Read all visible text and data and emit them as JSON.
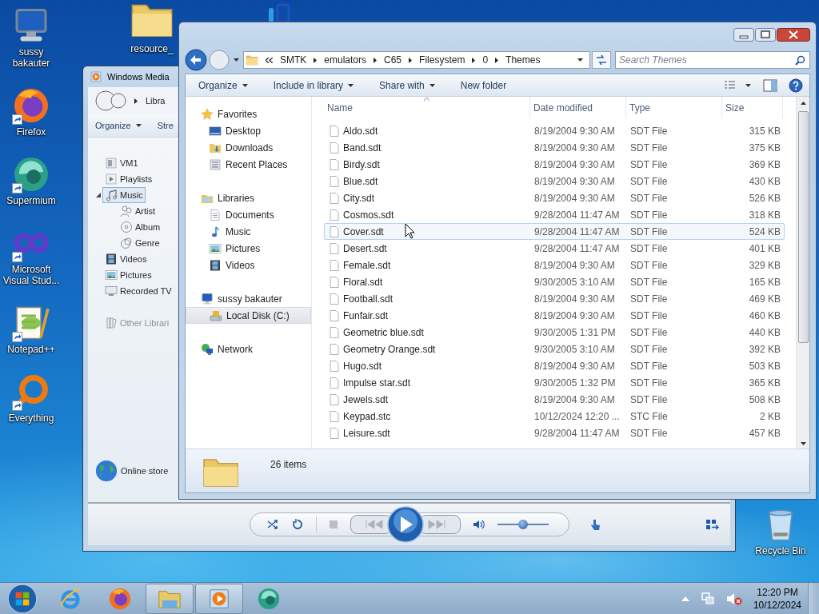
{
  "desktop_icons": [
    {
      "label": "sussy bakauter",
      "kind": "computer",
      "shortcut": false
    },
    {
      "label": "Firefox",
      "kind": "firefox",
      "shortcut": true
    },
    {
      "label": "Supermium",
      "kind": "supermium",
      "shortcut": true
    },
    {
      "label": "Microsoft Visual Stud...",
      "kind": "vs",
      "shortcut": true
    },
    {
      "label": "Notepad++",
      "kind": "notepad",
      "shortcut": true
    },
    {
      "label": "Everything",
      "kind": "everything",
      "shortcut": true
    }
  ],
  "desktop_folder": {
    "label": "resource_"
  },
  "recycle_bin": {
    "label": "Recycle Bin"
  },
  "media_player": {
    "title": "Windows Media",
    "breadcrumb": "Libra",
    "toolbar": [
      {
        "label": "Organize",
        "dropdown": true
      },
      {
        "label": "Stre",
        "dropdown": false
      }
    ],
    "tree": [
      {
        "label": "VM1",
        "kind": "device",
        "selected": false
      },
      {
        "label": "Playlists",
        "kind": "playlist",
        "selected": false
      },
      {
        "label": "Music",
        "kind": "music",
        "selected": true,
        "expanded": true,
        "children": [
          {
            "label": "Artist",
            "kind": "artist",
            "selected": false
          },
          {
            "label": "Album",
            "kind": "album",
            "selected": false
          },
          {
            "label": "Genre",
            "kind": "genre",
            "selected": false
          }
        ]
      },
      {
        "label": "Videos",
        "kind": "video",
        "selected": false
      },
      {
        "label": "Pictures",
        "kind": "picture",
        "selected": false
      },
      {
        "label": "Recorded TV",
        "kind": "tv",
        "selected": false
      }
    ],
    "other_libraries": "Other Librari",
    "online_store": "Online store",
    "volume": {
      "level": 0.5
    }
  },
  "explorer": {
    "address": [
      "SMTK",
      "emulators",
      "C65",
      "Filesystem",
      "0",
      "Themes"
    ],
    "search": {
      "placeholder": "Search Themes"
    },
    "toolbar": [
      {
        "label": "Organize",
        "dropdown": true
      },
      {
        "label": "Include in library",
        "dropdown": true
      },
      {
        "label": "Share with",
        "dropdown": true
      },
      {
        "label": "New folder",
        "dropdown": false
      }
    ],
    "navigation": [
      {
        "label": "Favorites",
        "kind": "star",
        "selected": false,
        "children": [
          {
            "label": "Desktop",
            "kind": "desktop",
            "selected": false
          },
          {
            "label": "Downloads",
            "kind": "downloads",
            "selected": false
          },
          {
            "label": "Recent Places",
            "kind": "recent",
            "selected": false
          }
        ]
      },
      {
        "label": "Libraries",
        "kind": "library",
        "selected": false,
        "children": [
          {
            "label": "Documents",
            "kind": "document",
            "selected": false
          },
          {
            "label": "Music",
            "kind": "note",
            "selected": false
          },
          {
            "label": "Pictures",
            "kind": "picture",
            "selected": false
          },
          {
            "label": "Videos",
            "kind": "video",
            "selected": false
          }
        ]
      },
      {
        "label": "sussy bakauter",
        "kind": "computer",
        "selected": false,
        "children": [
          {
            "label": "Local Disk (C:)",
            "kind": "disk",
            "selected": true
          }
        ]
      },
      {
        "label": "Network",
        "kind": "network",
        "selected": false
      }
    ],
    "columns": [
      {
        "label": "Name",
        "sorted": true
      },
      {
        "label": "Date modified",
        "sorted": false
      },
      {
        "label": "Type",
        "sorted": false
      },
      {
        "label": "Size",
        "sorted": false
      }
    ],
    "files": [
      {
        "name": "Aldo.sdt",
        "date": "8/19/2004 9:30 AM",
        "type": "SDT File",
        "size": "315 KB",
        "hovered": false
      },
      {
        "name": "Band.sdt",
        "date": "8/19/2004 9:30 AM",
        "type": "SDT File",
        "size": "375 KB",
        "hovered": false
      },
      {
        "name": "Birdy.sdt",
        "date": "8/19/2004 9:30 AM",
        "type": "SDT File",
        "size": "369 KB",
        "hovered": false
      },
      {
        "name": "Blue.sdt",
        "date": "8/19/2004 9:30 AM",
        "type": "SDT File",
        "size": "430 KB",
        "hovered": false
      },
      {
        "name": "City.sdt",
        "date": "8/19/2004 9:30 AM",
        "type": "SDT File",
        "size": "526 KB",
        "hovered": false
      },
      {
        "name": "Cosmos.sdt",
        "date": "9/28/2004 11:47 AM",
        "type": "SDT File",
        "size": "318 KB",
        "hovered": false
      },
      {
        "name": "Cover.sdt",
        "date": "9/28/2004 11:47 AM",
        "type": "SDT File",
        "size": "524 KB",
        "hovered": true
      },
      {
        "name": "Desert.sdt",
        "date": "9/28/2004 11:47 AM",
        "type": "SDT File",
        "size": "401 KB",
        "hovered": false
      },
      {
        "name": "Female.sdt",
        "date": "8/19/2004 9:30 AM",
        "type": "SDT File",
        "size": "329 KB",
        "hovered": false
      },
      {
        "name": "Floral.sdt",
        "date": "9/30/2005 3:10 AM",
        "type": "SDT File",
        "size": "165 KB",
        "hovered": false
      },
      {
        "name": "Football.sdt",
        "date": "8/19/2004 9:30 AM",
        "type": "SDT File",
        "size": "469 KB",
        "hovered": false
      },
      {
        "name": "Funfair.sdt",
        "date": "8/19/2004 9:30 AM",
        "type": "SDT File",
        "size": "460 KB",
        "hovered": false
      },
      {
        "name": "Geometric blue.sdt",
        "date": "9/30/2005 1:31 PM",
        "type": "SDT File",
        "size": "440 KB",
        "hovered": false
      },
      {
        "name": "Geometry Orange.sdt",
        "date": "9/30/2005 3:10 AM",
        "type": "SDT File",
        "size": "392 KB",
        "hovered": false
      },
      {
        "name": "Hugo.sdt",
        "date": "8/19/2004 9:30 AM",
        "type": "SDT File",
        "size": "503 KB",
        "hovered": false
      },
      {
        "name": "Impulse star.sdt",
        "date": "9/30/2005 1:32 PM",
        "type": "SDT File",
        "size": "365 KB",
        "hovered": false
      },
      {
        "name": "Jewels.sdt",
        "date": "8/19/2004 9:30 AM",
        "type": "SDT File",
        "size": "508 KB",
        "hovered": false
      },
      {
        "name": "Keypad.stc",
        "date": "10/12/2024 12:20 ...",
        "type": "STC File",
        "size": "2 KB",
        "hovered": false
      },
      {
        "name": "Leisure.sdt",
        "date": "9/28/2004 11:47 AM",
        "type": "SDT File",
        "size": "457 KB",
        "hovered": false
      }
    ],
    "status": "26 items"
  },
  "taskbar": {
    "apps": [
      {
        "kind": "ie",
        "open": false
      },
      {
        "kind": "firefox",
        "open": false
      },
      {
        "kind": "explorer",
        "open": true
      },
      {
        "kind": "wmp",
        "open": true
      },
      {
        "kind": "supermium",
        "open": false
      }
    ],
    "volume_muted": true,
    "time": "12:20 PM",
    "date": "10/12/2024"
  }
}
